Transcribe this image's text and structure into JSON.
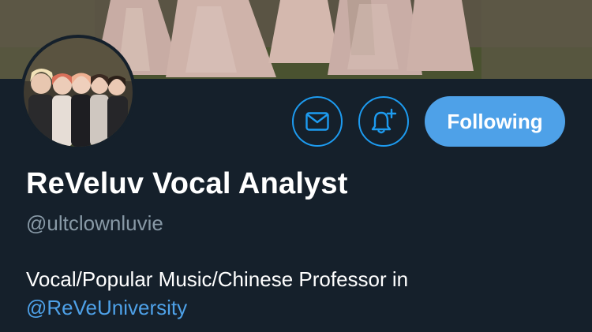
{
  "profile": {
    "display_name": "ReVeluv Vocal Analyst",
    "handle": "@ultclownluvie",
    "bio_text": "Vocal/Popular Music/Chinese Professor in",
    "bio_mention": "@ReVeUniversity"
  },
  "actions": {
    "message_icon": "envelope-icon",
    "notify_icon": "bell-plus-icon",
    "follow_label": "Following"
  },
  "colors": {
    "background": "#15202b",
    "accent": "#4ea1e8",
    "handle": "#8899a6",
    "text": "#ffffff"
  }
}
